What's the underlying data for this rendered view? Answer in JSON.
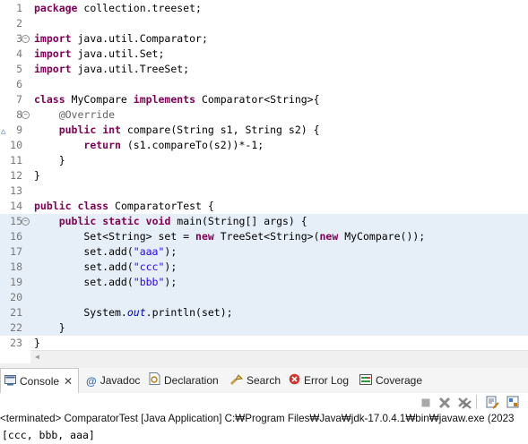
{
  "editor": {
    "lines": [
      {
        "n": "1",
        "html": "<span class=\"kw\">package</span> collection.treeset;"
      },
      {
        "n": "2",
        "html": ""
      },
      {
        "n": "3",
        "fold": true,
        "html": "<span class=\"kw\">import</span> java.util.Comparator;"
      },
      {
        "n": "4",
        "html": "<span class=\"kw\">import</span> java.util.Set;"
      },
      {
        "n": "5",
        "html": "<span class=\"kw\">import</span> java.util.TreeSet;"
      },
      {
        "n": "6",
        "html": ""
      },
      {
        "n": "7",
        "html": "<span class=\"kw\">class</span> MyCompare <span class=\"kw\">implements</span> Comparator&lt;String&gt;{"
      },
      {
        "n": "8",
        "fold": true,
        "html": "    <span class=\"ann\">@Override</span>"
      },
      {
        "n": "9",
        "marker": true,
        "html": "    <span class=\"kw\">public</span> <span class=\"kw\">int</span> compare(String s1, String s2) {"
      },
      {
        "n": "10",
        "html": "        <span class=\"kw\">return</span> (s1.compareTo(s2))*-1;"
      },
      {
        "n": "11",
        "html": "    }"
      },
      {
        "n": "12",
        "html": "}"
      },
      {
        "n": "13",
        "html": ""
      },
      {
        "n": "14",
        "html": "<span class=\"kw\">public</span> <span class=\"kw\">class</span> ComparatorTest {"
      },
      {
        "n": "15",
        "fold": true,
        "band": true,
        "html": "    <span class=\"kw\">public</span> <span class=\"kw\">static</span> <span class=\"kw\">void</span> main(String[] args) {"
      },
      {
        "n": "16",
        "band": true,
        "html": "        Set&lt;String&gt; set = <span class=\"kw\">new</span> TreeSet&lt;String&gt;(<span class=\"kw\">new</span> MyCompare());"
      },
      {
        "n": "17",
        "band": true,
        "html": "        set.add(<span class=\"str\">\"aaa\"</span>);"
      },
      {
        "n": "18",
        "band": true,
        "html": "        set.add(<span class=\"str\">\"ccc\"</span>);"
      },
      {
        "n": "19",
        "band": true,
        "html": "        set.add(<span class=\"str\">\"bbb\"</span>);"
      },
      {
        "n": "20",
        "band": true,
        "html": ""
      },
      {
        "n": "21",
        "band": true,
        "html": "        System.<span class=\"fld\">out</span>.println(set);"
      },
      {
        "n": "22",
        "band": true,
        "html": "    }"
      },
      {
        "n": "23",
        "html": "}"
      }
    ]
  },
  "tabs": {
    "console": "Console",
    "javadoc": "Javadoc",
    "declaration": "Declaration",
    "search": "Search",
    "errorlog": "Error Log",
    "coverage": "Coverage"
  },
  "console": {
    "status": "<terminated> ComparatorTest [Java Application] C:₩Program Files₩Java₩jdk-17.0.4.1₩bin₩javaw.exe  (2023",
    "output": "[ccc, bbb, aaa]"
  },
  "colors": {
    "keyword": "#7f0055",
    "string": "#2a00ff",
    "annotation": "#646464",
    "field": "#0000c0"
  }
}
